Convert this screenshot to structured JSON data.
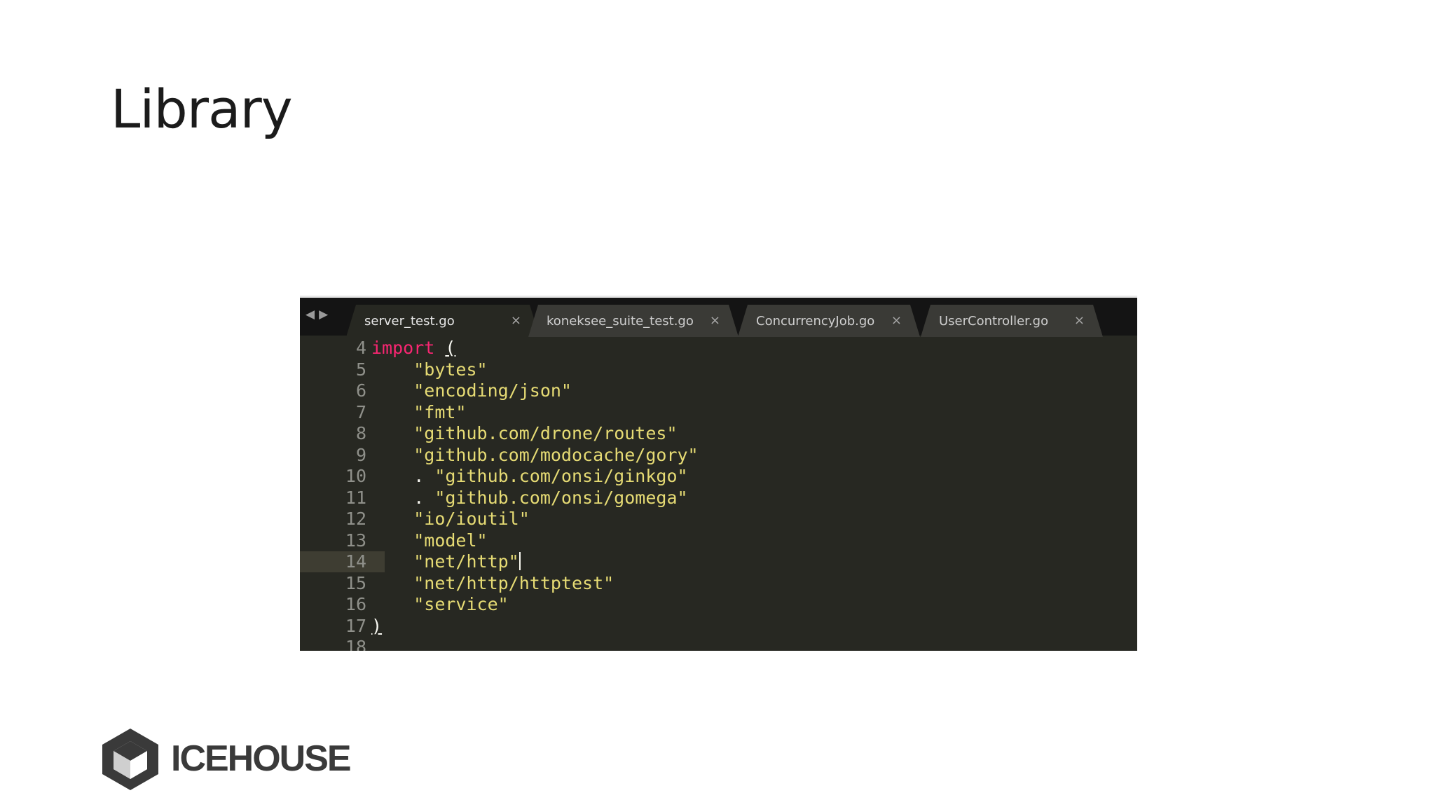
{
  "slide": {
    "title": "Library"
  },
  "editor": {
    "tabs": [
      {
        "label": "server_test.go",
        "close": "×",
        "active": true
      },
      {
        "label": "koneksee_suite_test.go",
        "close": "×",
        "active": false
      },
      {
        "label": "ConcurrencyJob.go",
        "close": "×",
        "active": false
      },
      {
        "label": "UserController.go",
        "close": "×",
        "active": false
      }
    ],
    "current_line": 14,
    "lines": [
      {
        "num": "4",
        "tokens": [
          {
            "t": "kw",
            "v": "import"
          },
          {
            "t": "plain",
            "v": " "
          },
          {
            "t": "paren",
            "v": "("
          }
        ]
      },
      {
        "num": "5",
        "tokens": [
          {
            "t": "plain",
            "v": "    "
          },
          {
            "t": "str",
            "v": "\"bytes\""
          }
        ]
      },
      {
        "num": "6",
        "tokens": [
          {
            "t": "plain",
            "v": "    "
          },
          {
            "t": "str",
            "v": "\"encoding/json\""
          }
        ]
      },
      {
        "num": "7",
        "tokens": [
          {
            "t": "plain",
            "v": "    "
          },
          {
            "t": "str",
            "v": "\"fmt\""
          }
        ]
      },
      {
        "num": "8",
        "tokens": [
          {
            "t": "plain",
            "v": "    "
          },
          {
            "t": "str",
            "v": "\"github.com/drone/routes\""
          }
        ]
      },
      {
        "num": "9",
        "tokens": [
          {
            "t": "plain",
            "v": "    "
          },
          {
            "t": "str",
            "v": "\"github.com/modocache/gory\""
          }
        ]
      },
      {
        "num": "10",
        "tokens": [
          {
            "t": "plain",
            "v": "    . "
          },
          {
            "t": "str",
            "v": "\"github.com/onsi/ginkgo\""
          }
        ]
      },
      {
        "num": "11",
        "tokens": [
          {
            "t": "plain",
            "v": "    . "
          },
          {
            "t": "str",
            "v": "\"github.com/onsi/gomega\""
          }
        ]
      },
      {
        "num": "12",
        "tokens": [
          {
            "t": "plain",
            "v": "    "
          },
          {
            "t": "str",
            "v": "\"io/ioutil\""
          }
        ]
      },
      {
        "num": "13",
        "tokens": [
          {
            "t": "plain",
            "v": "    "
          },
          {
            "t": "str",
            "v": "\"model\""
          }
        ]
      },
      {
        "num": "14",
        "tokens": [
          {
            "t": "plain",
            "v": "    "
          },
          {
            "t": "str",
            "v": "\"net/http\""
          },
          {
            "t": "cursor",
            "v": ""
          }
        ]
      },
      {
        "num": "15",
        "tokens": [
          {
            "t": "plain",
            "v": "    "
          },
          {
            "t": "str",
            "v": "\"net/http/httptest\""
          }
        ]
      },
      {
        "num": "16",
        "tokens": [
          {
            "t": "plain",
            "v": "    "
          },
          {
            "t": "str",
            "v": "\"service\""
          }
        ]
      },
      {
        "num": "17",
        "tokens": [
          {
            "t": "paren",
            "v": ")"
          }
        ]
      },
      {
        "num": "18",
        "tokens": []
      }
    ],
    "colors": {
      "background": "#272822",
      "keyword": "#f92672",
      "string": "#e6db74",
      "gutter_text": "#8f908a"
    }
  },
  "logo": {
    "text": "ICEHOUSE",
    "icon": "icehouse-hexagon-icon"
  }
}
